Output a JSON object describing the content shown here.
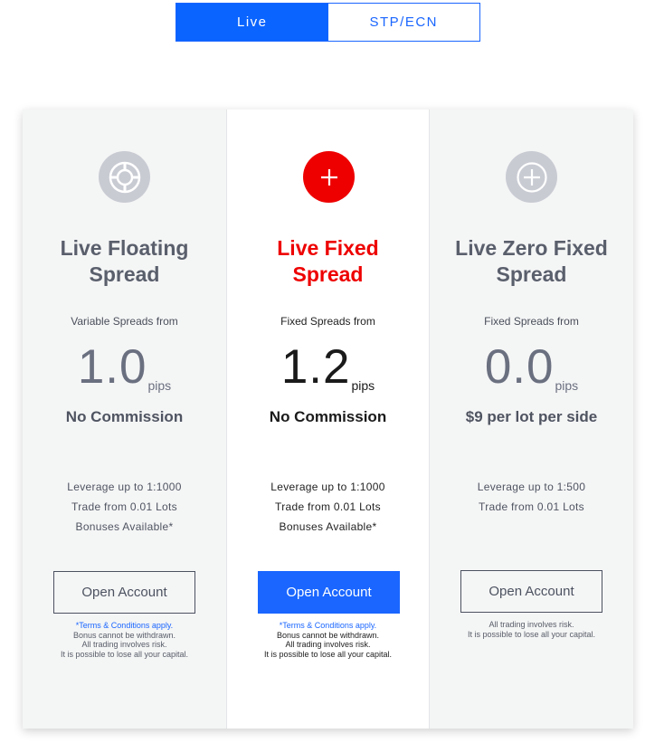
{
  "tabs": [
    {
      "label": "Live",
      "active": true
    },
    {
      "label": "STP/ECN",
      "active": false
    }
  ],
  "colors": {
    "accent": "#1a66ff",
    "highlight_red": "#ee0000",
    "grey_card": "#f4f5f5"
  },
  "cards": [
    {
      "icon": "lifebuoy-icon",
      "title_line1": "Live Floating",
      "title_line2": "Spread",
      "spread_label": "Variable Spreads from",
      "pips_value": "1.0",
      "pips_unit": "pips",
      "commission": "No Commission",
      "features": [
        "Leverage up to 1:1000",
        "Trade from 0.01 Lots",
        "Bonuses Available*"
      ],
      "button_label": "Open Account",
      "terms_link": "*Terms & Conditions apply.",
      "disclaimer": [
        "Bonus cannot be withdrawn.",
        "All trading involves risk.",
        "It is possible to lose all your capital."
      ]
    },
    {
      "icon": "plus-icon",
      "title_line1": "Live Fixed",
      "title_line2": "Spread",
      "spread_label": "Fixed Spreads from",
      "pips_value": "1.2",
      "pips_unit": "pips",
      "commission": "No Commission",
      "features": [
        "Leverage up to 1:1000",
        "Trade from 0.01 Lots",
        "Bonuses Available*"
      ],
      "button_label": "Open Account",
      "terms_link": "*Terms & Conditions apply.",
      "disclaimer": [
        "Bonus cannot be withdrawn.",
        "All trading involves risk.",
        "It is possible to lose all your capital."
      ]
    },
    {
      "icon": "circle-plus-icon",
      "title_line1": "Live Zero Fixed",
      "title_line2": "Spread",
      "spread_label": "Fixed Spreads from",
      "pips_value": "0.0",
      "pips_unit": "pips",
      "commission": "$9 per lot per side",
      "features": [
        "Leverage up to 1:500",
        "Trade from 0.01 Lots"
      ],
      "button_label": "Open Account",
      "disclaimer": [
        "All trading involves risk.",
        "It is possible to lose all your capital."
      ]
    }
  ]
}
